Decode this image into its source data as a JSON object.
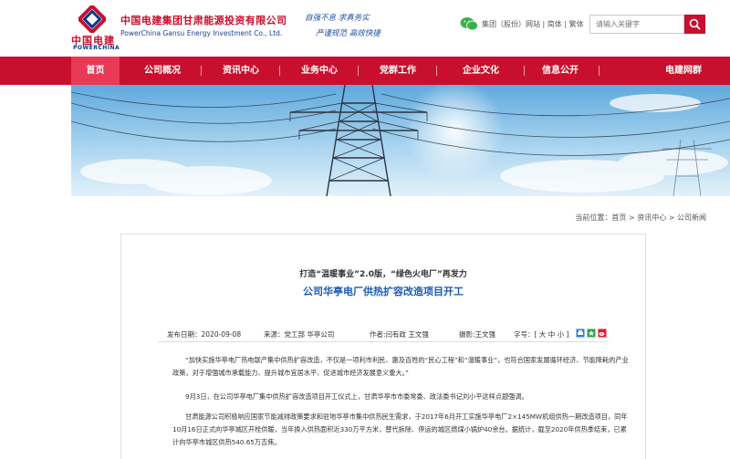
{
  "header": {
    "logo_cn": "中国电建",
    "logo_en": "POWERCHINA",
    "company_cn": "中国电建集团甘肃能源投资有限公司",
    "company_en": "PowerChina Gansu Energy Investment Co., Ltd.",
    "slogan_line1": "自强不息 求真务实",
    "slogan_line2": "严谨规范 高效快捷",
    "links": [
      "集团（股份）网站",
      "简体",
      "繁体"
    ],
    "link_sep": "|",
    "search_placeholder": "请输入关键字"
  },
  "nav": {
    "items": [
      "首页",
      "公司概况",
      "资讯中心",
      "业务中心",
      "党群工作",
      "企业文化",
      "信息公开",
      "电建网群"
    ],
    "active_index": 0
  },
  "breadcrumb": {
    "prefix": "当前位置：",
    "items": [
      "首页",
      "资讯中心",
      "公司新闻"
    ],
    "sep": " > "
  },
  "article": {
    "pre_title": "打造“温暖事业”2.0版，“绿色火电厂”再发力",
    "title": "公司华亭电厂供热扩容改造项目开工",
    "meta": {
      "date": "发布日期：2020-09-08",
      "source": "来源：党工部 华亭公司",
      "author": "作者:闫有政 王文强",
      "photo": "摄影:王文强",
      "font_size": "字号：[ 大 中 小 ]"
    },
    "paragraphs": [
      "“加快实施华亭电厂热电联产集中供热扩容改造，不仅是一项利市利民、惠及百姓的“民心工程”和“温暖事业”，也符合国家发展循环经济、节能降耗的产业政策，对于增强城市承载能力、提升城市宜居水平、促进城市经济发展意义重大。”",
      "9月3日，在公司华亭电厂集中供热扩容改造项目开工仪式上，甘肃华亭市市委常委、政法委书记刘小平这样点题强调。",
      "甘肃能源公司积极响应国家节能减排政策要求和驻地华亭市集中供热民生需求，于2017年6月开工实施华亭电厂2×145MW机组供热一期改造项目，同年10月16日正式向华亭城区开栓供暖，当年换入供热面积近330万平方米，替代拆除、停运的城区燃煤小锅炉40余台。据统计，截至2020年供热季结束，已累计向华亭市城区供热540.65万吉焦。"
    ]
  },
  "colors": {
    "brand_red": "#c8102e",
    "nav_active": "#e83a55",
    "title_blue": "#1d5ab0"
  }
}
